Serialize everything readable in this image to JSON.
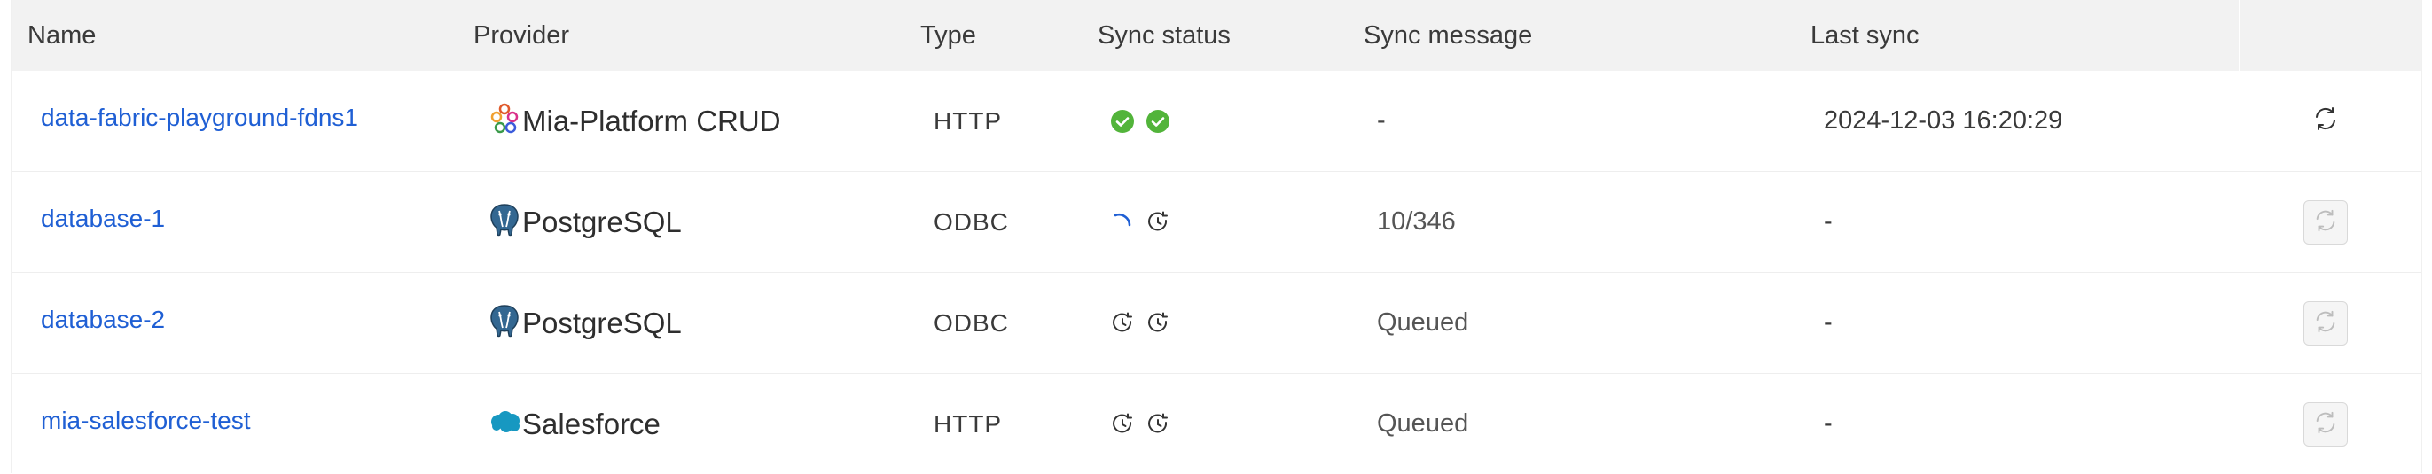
{
  "table": {
    "columns": [
      {
        "key": "name",
        "label": "Name"
      },
      {
        "key": "provider",
        "label": "Provider"
      },
      {
        "key": "type",
        "label": "Type"
      },
      {
        "key": "sync_status",
        "label": "Sync status"
      },
      {
        "key": "sync_message",
        "label": "Sync message"
      },
      {
        "key": "last_sync",
        "label": "Last sync"
      }
    ],
    "rows": [
      {
        "name": "data-fabric-playground-fdns1",
        "provider": {
          "label": "Mia-Platform CRUD",
          "icon": "mia-platform-logo-icon"
        },
        "type": "HTTP",
        "sync_status": [
          "success",
          "success"
        ],
        "sync_message": "-",
        "last_sync": "2024-12-03 16:20:29",
        "sync_enabled": true
      },
      {
        "name": "database-1",
        "provider": {
          "label": "PostgreSQL",
          "icon": "postgresql-logo-icon"
        },
        "type": "ODBC",
        "sync_status": [
          "loading",
          "pending"
        ],
        "sync_message": "10/346",
        "last_sync": "-",
        "sync_enabled": false
      },
      {
        "name": "database-2",
        "provider": {
          "label": "PostgreSQL",
          "icon": "postgresql-logo-icon"
        },
        "type": "ODBC",
        "sync_status": [
          "pending",
          "pending"
        ],
        "sync_message": "Queued",
        "last_sync": "-",
        "sync_enabled": false
      },
      {
        "name": "mia-salesforce-test",
        "provider": {
          "label": "Salesforce",
          "icon": "salesforce-logo-icon"
        },
        "type": "HTTP",
        "sync_status": [
          "pending",
          "pending"
        ],
        "sync_message": "Queued",
        "last_sync": "-",
        "sync_enabled": false
      }
    ]
  },
  "colors": {
    "link": "#1f5fd4",
    "success": "#52b43a",
    "loading": "#1f5fd4",
    "header_bg": "#f2f2f2"
  }
}
